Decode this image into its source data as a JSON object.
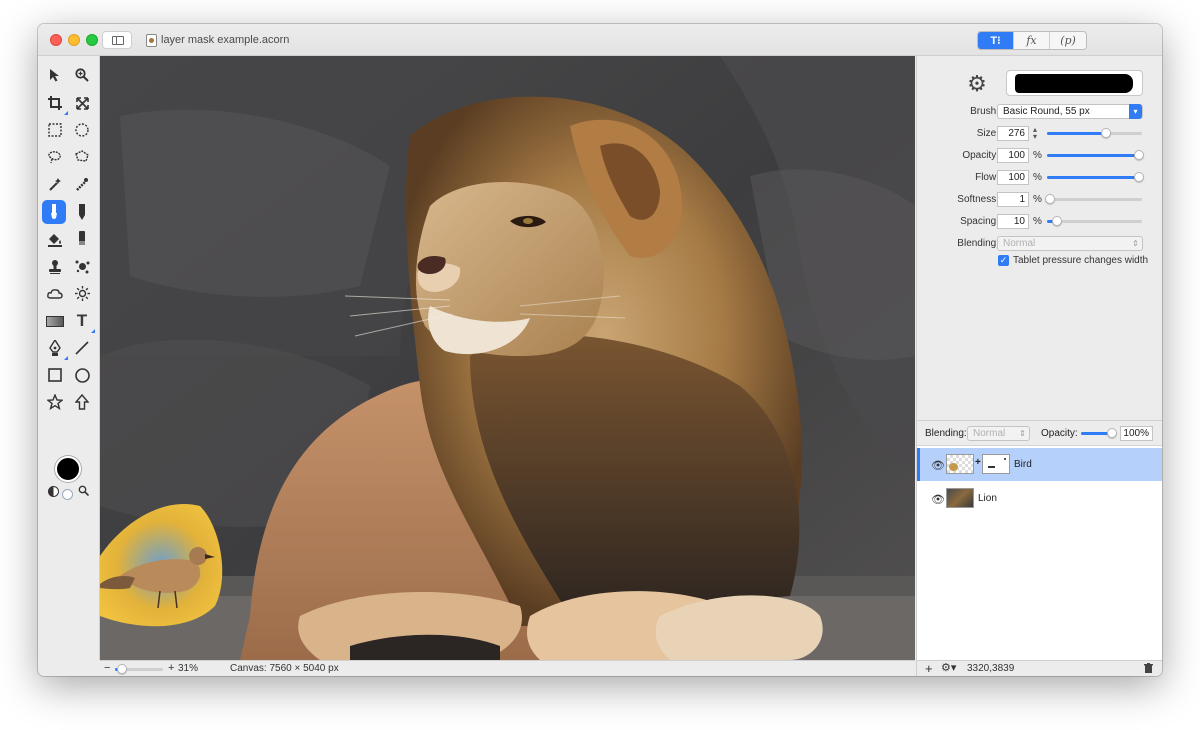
{
  "window": {
    "document_title": "layer mask example.acorn"
  },
  "modes": {
    "tools_label": "🖌",
    "fx_label": "fx",
    "p_label": "(p)"
  },
  "brush_panel": {
    "brush_label": "Brush:",
    "brush_value": "Basic Round, 55 px",
    "size_label": "Size:",
    "size_value": "276",
    "size_fraction": 0.62,
    "opacity_label": "Opacity:",
    "opacity_value": "100",
    "opacity_fraction": 1.0,
    "flow_label": "Flow:",
    "flow_value": "100",
    "flow_fraction": 1.0,
    "softness_label": "Softness:",
    "softness_value": "1",
    "softness_fraction": 0.01,
    "spacing_label": "Spacing:",
    "spacing_value": "10",
    "spacing_fraction": 0.1,
    "percent": "%",
    "blending_label": "Blending:",
    "blending_value": "Normal",
    "tablet_label": "Tablet pressure changes width",
    "tablet_checked": true
  },
  "layers_panel": {
    "blending_label": "Blending:",
    "blending_value": "Normal",
    "opacity_label": "Opacity:",
    "opacity_value": "100%",
    "opacity_fraction": 1.0,
    "layers": [
      {
        "name": "Bird",
        "selected": true
      },
      {
        "name": "Lion",
        "selected": false
      }
    ],
    "coordinates": "3320,3839"
  },
  "statusbar": {
    "zoom_out": "−",
    "zoom_in": "+",
    "zoom_value": "31%",
    "zoom_fraction": 0.1,
    "canvas_info": "Canvas: 7560 × 5040 px"
  },
  "colors": {
    "accent": "#2f7cf6",
    "foreground_color": "#000000",
    "selection_row": "#b5d0fb"
  },
  "icons": {
    "toolbar": [
      "arrow-icon",
      "zoom-icon",
      "crop-icon",
      "transform-icon",
      "rect-select-icon",
      "ellipse-select-icon",
      "lasso-icon",
      "polygon-lasso-icon",
      "magic-wand-icon",
      "color-wand-icon",
      "brush-icon",
      "pencil-icon",
      "paint-bucket-icon",
      "eraser-icon",
      "stamp-icon",
      "splatter-icon",
      "cloud-icon",
      "sun-icon",
      "gradient-icon",
      "text-icon",
      "pen-icon",
      "line-icon",
      "rectangle-icon",
      "circle-icon",
      "star-icon",
      "arrow-up-icon"
    ]
  }
}
